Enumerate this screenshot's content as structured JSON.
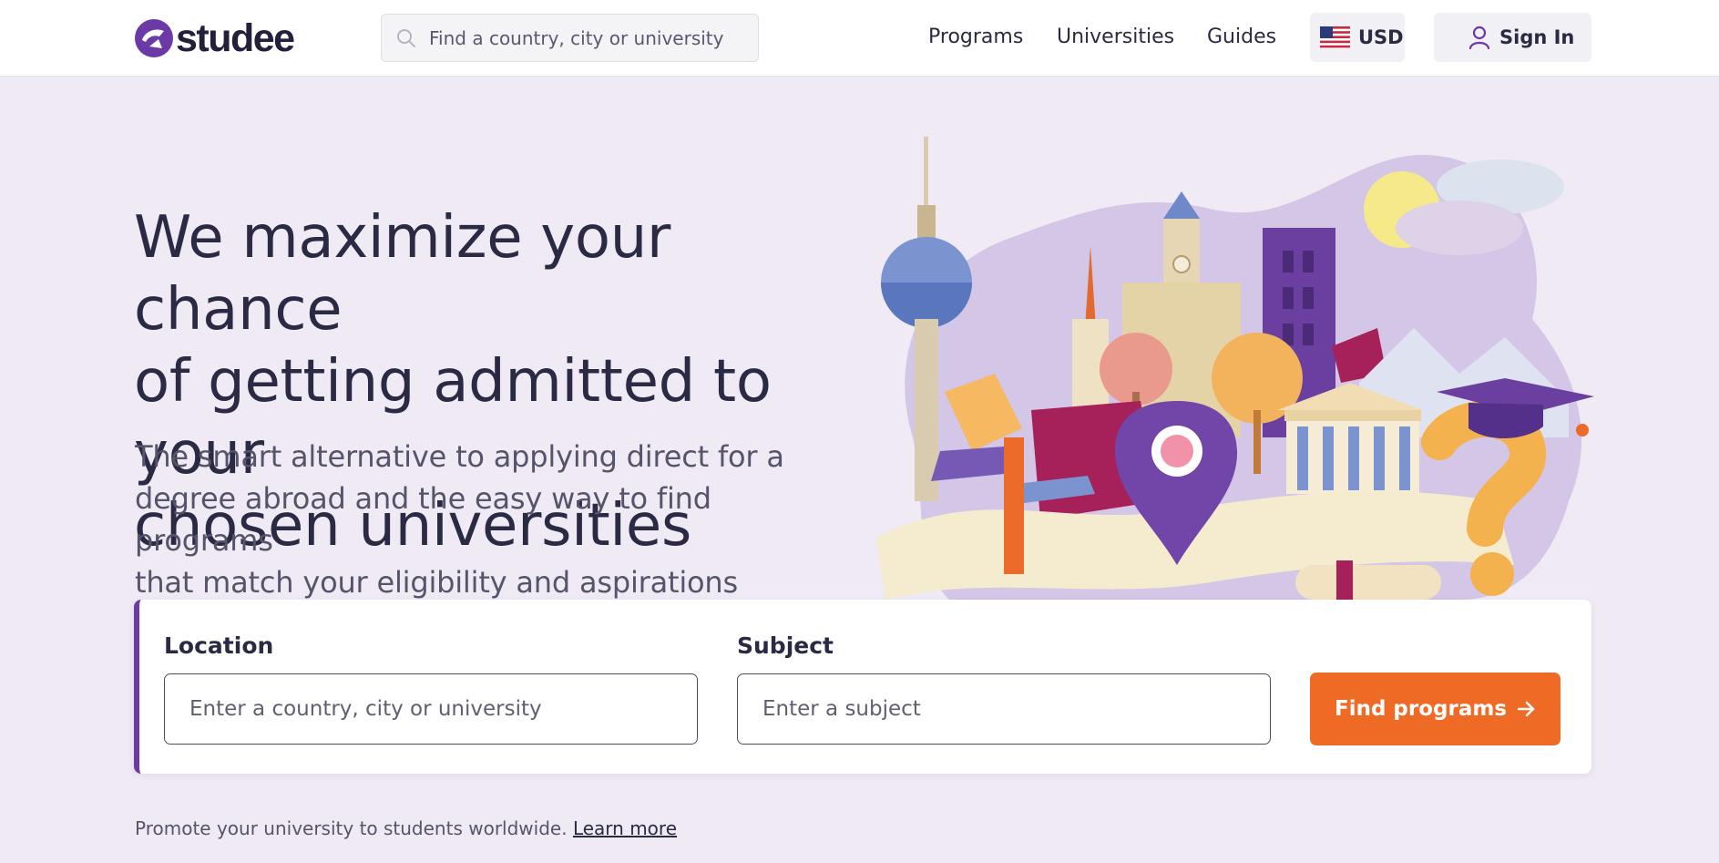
{
  "header": {
    "logo_text": "studee",
    "search_placeholder": "Find a country, city or university",
    "nav": {
      "programs": "Programs",
      "universities": "Universities",
      "guides": "Guides"
    },
    "currency": "USD",
    "sign_in": "Sign In"
  },
  "hero": {
    "headline_lines": [
      "We maximize your chance",
      "of getting admitted to your",
      "chosen universities"
    ],
    "subhead_lines": [
      "The smart alternative to applying direct for a",
      "degree abroad and the easy way to find programs",
      "that match your eligibility and aspirations"
    ]
  },
  "search_card": {
    "location_label": "Location",
    "location_placeholder": "Enter a country, city or university",
    "subject_label": "Subject",
    "subject_placeholder": "Enter a subject",
    "button_label": "Find programs"
  },
  "promo": {
    "text": "Promote your university to students worldwide.",
    "link": "Learn more"
  },
  "colors": {
    "brand_purple": "#6b3aa6",
    "accent_orange": "#ef6a25",
    "page_bg": "#efeaf4",
    "text_dark": "#2b2a44"
  },
  "icons": [
    "studee-logo-icon",
    "search-icon",
    "us-flag-icon",
    "user-icon",
    "arrow-right-icon"
  ]
}
